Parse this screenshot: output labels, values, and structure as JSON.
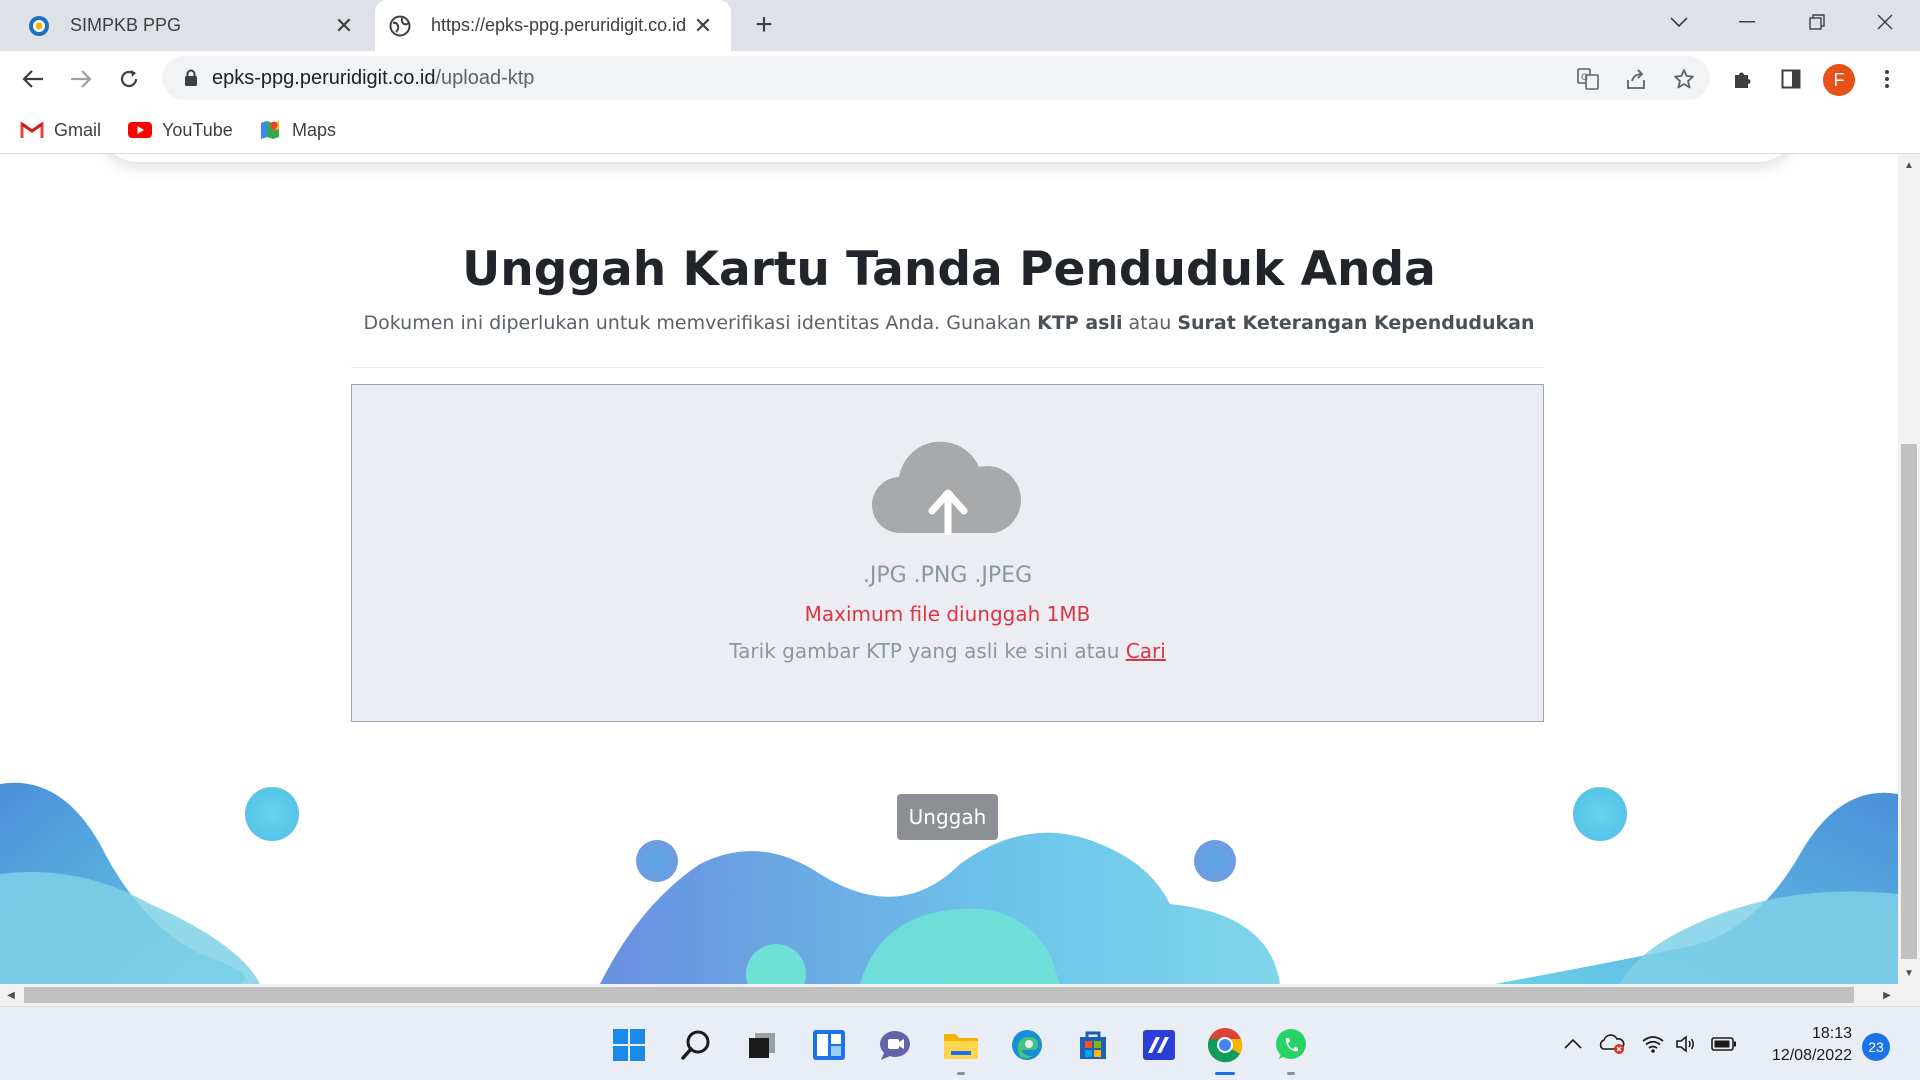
{
  "browser": {
    "tabs": [
      {
        "title": "SIMPKB PPG",
        "active": false
      },
      {
        "title": "https://epks-ppg.peruridigit.co.id",
        "active": true
      }
    ],
    "address": {
      "host": "epks-ppg.peruridigit.co.id",
      "path": "/upload-ktp"
    },
    "profile_initial": "F",
    "bookmarks": [
      "Gmail",
      "YouTube",
      "Maps"
    ]
  },
  "page": {
    "heading": "Unggah Kartu Tanda Penduduk Anda",
    "subtext_prefix": "Dokumen ini diperlukan untuk memverifikasi identitas Anda. Gunakan ",
    "subtext_bold1": "KTP asli",
    "subtext_mid": " atau ",
    "subtext_bold2": "Surat Keterangan Kependudukan",
    "dropzone": {
      "formats": ".JPG .PNG .JPEG",
      "max_size": "Maximum file diunggah 1MB",
      "drag_text": "Tarik gambar KTP yang asli ke sini atau ",
      "browse_link": "Cari"
    },
    "upload_button": "Unggah"
  },
  "taskbar": {
    "apps": [
      "start-icon",
      "search-icon",
      "task-view-icon",
      "widgets-icon",
      "teams-chat-icon",
      "file-explorer-icon",
      "edge-icon",
      "store-icon",
      "app-icon",
      "chrome-icon",
      "whatsapp-icon"
    ],
    "time": "18:13",
    "date": "12/08/2022",
    "notification_count": "23"
  },
  "colors": {
    "accent_red": "#dc3545",
    "button_gray": "#8c8f93",
    "dropzone_bg": "#ebedf2",
    "chrome_profile": "#e8501a"
  }
}
